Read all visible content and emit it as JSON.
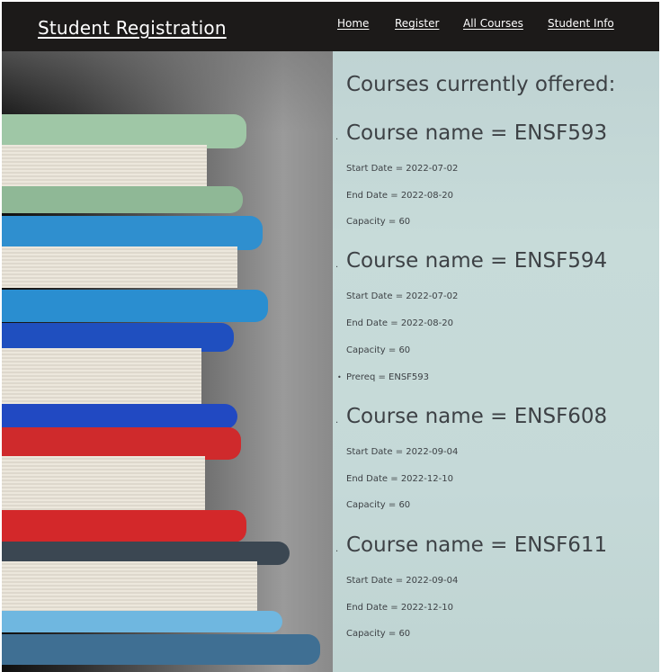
{
  "header": {
    "brand": "Student Registration",
    "nav": [
      "Home",
      "Register",
      "All Courses",
      "Student Info"
    ]
  },
  "main": {
    "heading": "Courses currently offered:",
    "courses": [
      {
        "name": "Course name = ENSF593",
        "start": "Start Date = 2022-07-02",
        "end": "End Date = 2022-08-20",
        "capacity": "Capacity = 60"
      },
      {
        "name": "Course name = ENSF594",
        "start": "Start Date = 2022-07-02",
        "end": "End Date = 2022-08-20",
        "capacity": "Capacity = 60",
        "prereq": "Prereq = ENSF593"
      },
      {
        "name": "Course name = ENSF608",
        "start": "Start Date = 2022-09-04",
        "end": "End Date = 2022-12-10",
        "capacity": "Capacity = 60"
      },
      {
        "name": "Course name = ENSF611",
        "start": "Start Date = 2022-09-04",
        "end": "End Date = 2022-12-10",
        "capacity": "Capacity = 60"
      }
    ]
  },
  "colors": {
    "header_bg": "#1c1a19",
    "content_bg": "#c5d9d8",
    "text": "#3d4145"
  },
  "image": {
    "subject": "stack-of-books-photo"
  }
}
